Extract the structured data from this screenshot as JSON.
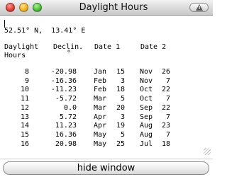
{
  "window": {
    "title": "Daylight Hours"
  },
  "location": "52.51° N,  13.41° E",
  "headers": {
    "col1_line1": "Daylight",
    "col1_line2": "Hours",
    "col2_line1": "Declin.",
    "col2_line2": "°",
    "col3": "Date 1",
    "col4": "Date 2"
  },
  "rows": [
    {
      "hours": "8",
      "declin": "-20.98",
      "d1m": "Jan",
      "d1d": "15",
      "d2m": "Nov",
      "d2d": "26"
    },
    {
      "hours": "9",
      "declin": "-16.36",
      "d1m": "Feb",
      "d1d": "3",
      "d2m": "Nov",
      "d2d": "7"
    },
    {
      "hours": "10",
      "declin": "-11.23",
      "d1m": "Feb",
      "d1d": "18",
      "d2m": "Oct",
      "d2d": "22"
    },
    {
      "hours": "11",
      "declin": "-5.72",
      "d1m": "Mar",
      "d1d": "5",
      "d2m": "Oct",
      "d2d": "7"
    },
    {
      "hours": "12",
      "declin": "0.0",
      "d1m": "Mar",
      "d1d": "20",
      "d2m": "Sep",
      "d2d": "22"
    },
    {
      "hours": "13",
      "declin": "5.72",
      "d1m": "Apr",
      "d1d": "3",
      "d2m": "Sep",
      "d2d": "7"
    },
    {
      "hours": "14",
      "declin": "11.23",
      "d1m": "Apr",
      "d1d": "19",
      "d2m": "Aug",
      "d2d": "23"
    },
    {
      "hours": "15",
      "declin": "16.36",
      "d1m": "May",
      "d1d": "5",
      "d2m": "Aug",
      "d2d": "7"
    },
    {
      "hours": "16",
      "declin": "20.98",
      "d1m": "May",
      "d1d": "25",
      "d2m": "Jul",
      "d2d": "18"
    }
  ],
  "footer": {
    "hide_label": "hide window"
  }
}
